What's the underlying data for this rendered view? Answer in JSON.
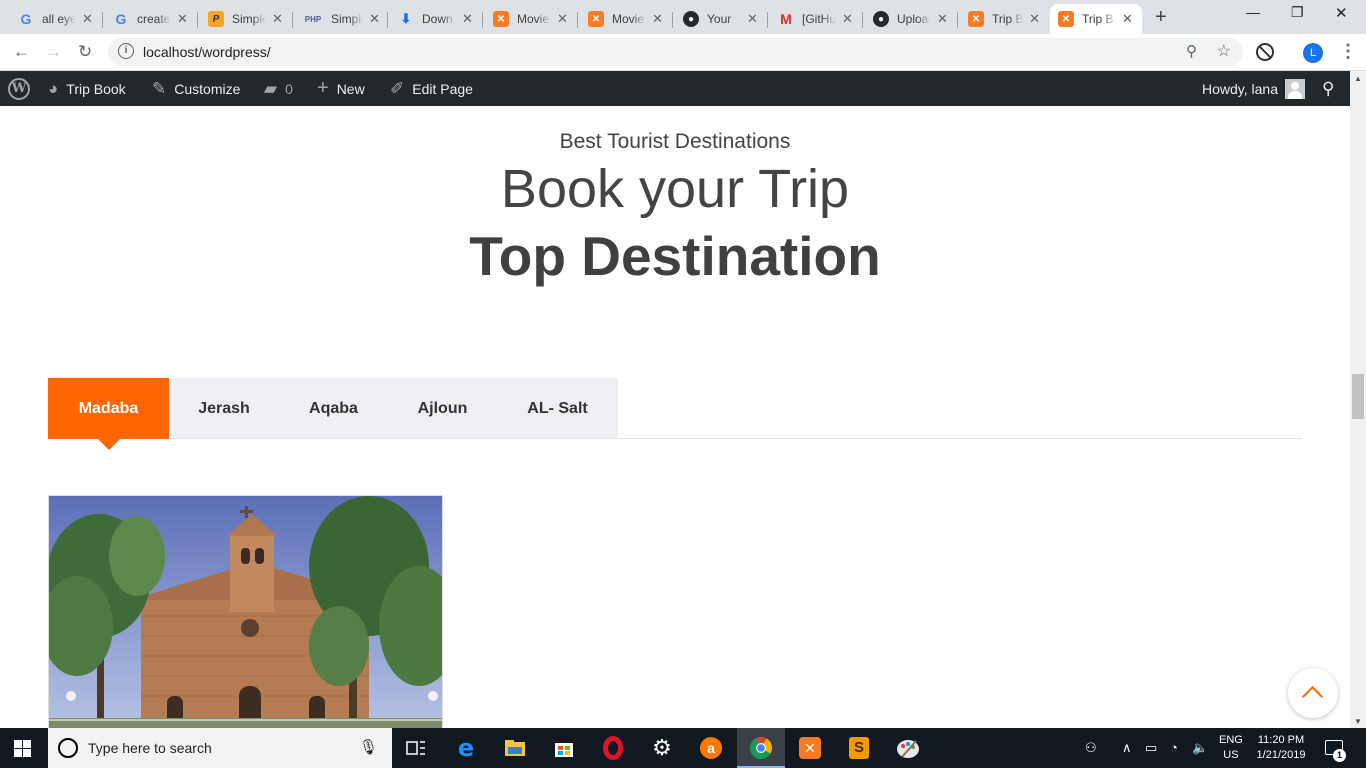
{
  "browser": {
    "tabs": [
      {
        "title": "all eyes",
        "icon": "google-icon",
        "active": false
      },
      {
        "title": "create",
        "icon": "google-icon",
        "active": false
      },
      {
        "title": "Simple",
        "icon": "pdf-icon",
        "active": false
      },
      {
        "title": "Simple",
        "icon": "php-icon",
        "active": false
      },
      {
        "title": "Down",
        "icon": "download-icon",
        "active": false
      },
      {
        "title": "Movie",
        "icon": "xampp-icon",
        "active": false
      },
      {
        "title": "Movie",
        "icon": "xampp-icon",
        "active": false
      },
      {
        "title": "Your",
        "icon": "github-icon",
        "active": false
      },
      {
        "title": "[GitHub",
        "icon": "gmail-icon",
        "active": false
      },
      {
        "title": "Upload",
        "icon": "github-icon",
        "active": false
      },
      {
        "title": "Trip B",
        "icon": "xampp-icon",
        "active": false
      },
      {
        "title": "Trip B",
        "icon": "xampp-icon",
        "active": true
      }
    ],
    "php_badge": "PHP",
    "url": "localhost/wordpress/",
    "profile_initial": "L"
  },
  "admin_bar": {
    "site_name": "Trip Book",
    "customize": "Customize",
    "comments_count": "0",
    "new": "New",
    "edit_page": "Edit Page",
    "howdy": "Howdy, lana"
  },
  "page": {
    "subtitle": "Best Tourist Destinations",
    "title": "Book your Trip",
    "heading": "Top Destination",
    "destination_tabs": [
      "Madaba",
      "Jerash",
      "Aqaba",
      "Ajloun",
      "AL- Salt"
    ],
    "active_tab": "Madaba"
  },
  "taskbar": {
    "search_placeholder": "Type here to search",
    "language": "ENG",
    "region": "US",
    "time": "11:20 PM",
    "date": "1/21/2019",
    "notification_count": "1"
  },
  "colors": {
    "accent": "#ff6600",
    "admin_bar_bg": "#23282d",
    "heading_text": "#444444",
    "tab_bar_bg": "#eef0f3"
  }
}
